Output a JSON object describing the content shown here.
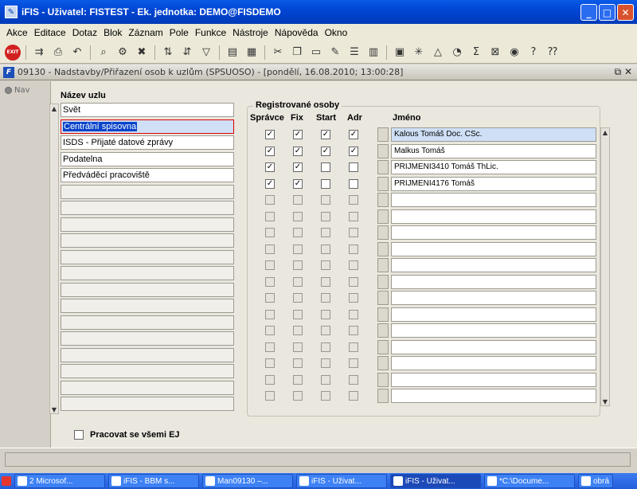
{
  "window": {
    "title": "iFIS - Uživatel: FISTEST - Ek. jednotka: DEMO@FISDEMO",
    "minimize": "_",
    "maximize": "□",
    "close": "✕"
  },
  "menu": [
    "Akce",
    "Editace",
    "Dotaz",
    "Blok",
    "Záznam",
    "Pole",
    "Funkce",
    "Nástroje",
    "Nápověda",
    "Okno"
  ],
  "toolbar": {
    "exit_label": "EXIT"
  },
  "form": {
    "title": "09130 - Nadstavby/Přiřazení osob k uzlům (SPSUOSO) - [pondělí, 16.08.2010; 13:00:28]",
    "controls": "⧉ ✕",
    "nav_tab": "Nav"
  },
  "nodes": {
    "header": "Název uzlu",
    "items": [
      "Svět",
      "Centrální spisovna",
      "ISDS - Přijaté datové zprávy",
      "Podatelna",
      "Předváděcí pracoviště"
    ],
    "selected_index": 1,
    "total_rows": 19
  },
  "registered": {
    "group_title": "Registrované osoby",
    "columns": {
      "spravce": "Správce",
      "fix": "Fix",
      "start": "Start",
      "adr": "Adr",
      "name": "Jméno"
    },
    "rows": [
      {
        "name": "Kalous Tomáš Doc. CSc.",
        "spravce": true,
        "fix": true,
        "start": true,
        "adr": true
      },
      {
        "name": "Malkus Tomáš",
        "spravce": true,
        "fix": true,
        "start": true,
        "adr": true
      },
      {
        "name": "PRIJMENI3410 Tomáš ThLic.",
        "spravce": true,
        "fix": true,
        "start": false,
        "adr": false
      },
      {
        "name": "PRIJMENI4176 Tomáš",
        "spravce": true,
        "fix": true,
        "start": false,
        "adr": false
      }
    ],
    "total_rows": 17
  },
  "bottom": {
    "all_units_label": "Pracovat se všemi EJ"
  },
  "taskbar": {
    "items": [
      "2 Microsof...",
      "iFIS - BBM s...",
      "Man09130 –...",
      "iFIS - Uživat...",
      "iFIS - Uživat...",
      "*C:\\Docume...",
      "obrá"
    ],
    "active_index": 4
  }
}
